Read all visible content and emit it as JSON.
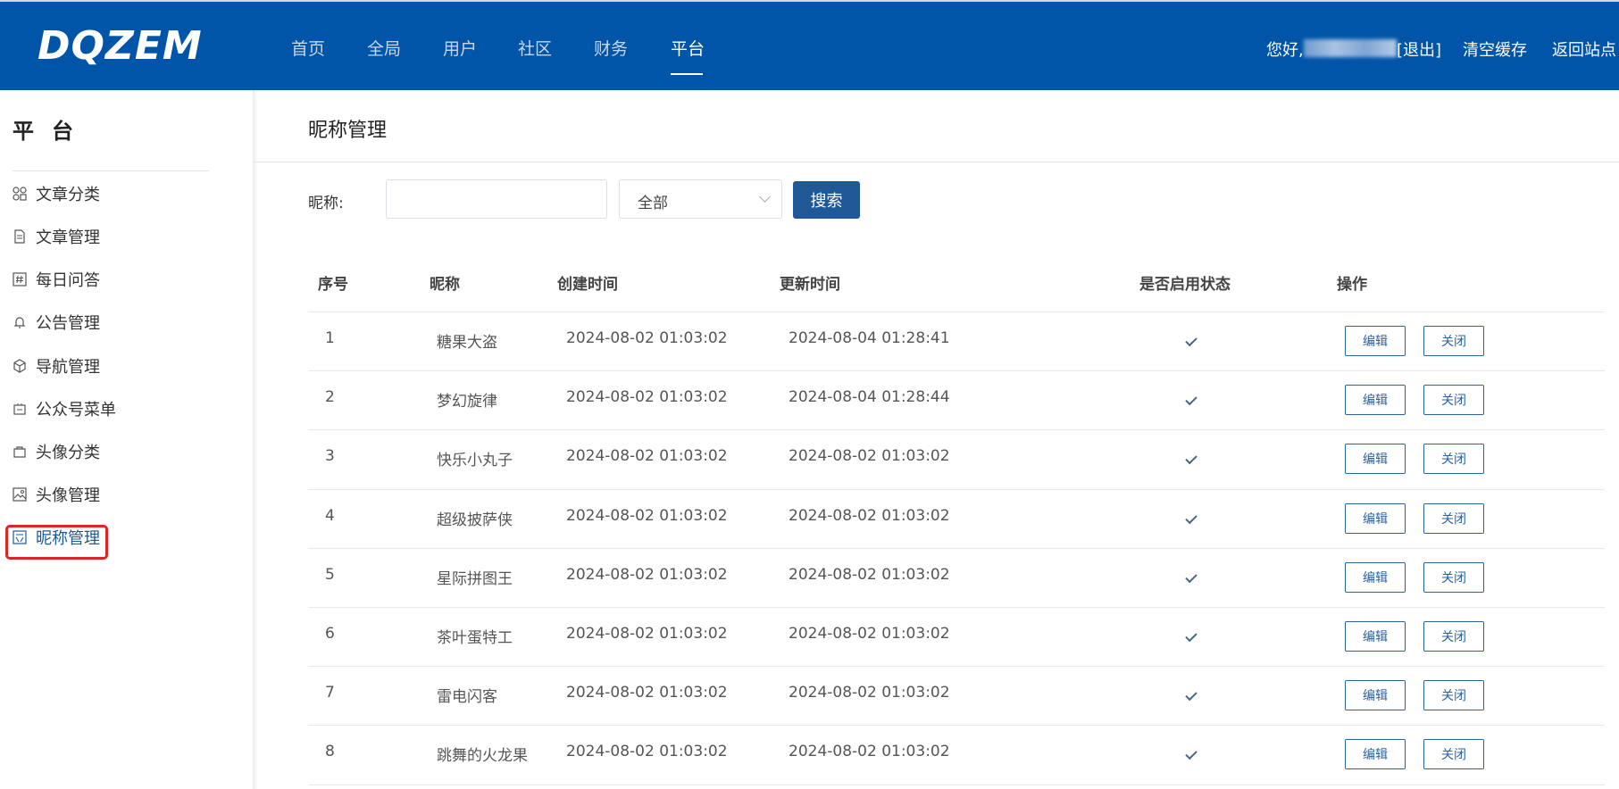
{
  "header": {
    "logo": "DQZEM",
    "nav": [
      "首页",
      "全局",
      "用户",
      "社区",
      "财务",
      "平台"
    ],
    "active_nav": "平台",
    "greeting": "您好,",
    "logout": "[退出]",
    "clear_cache": "清空缓存",
    "back_to_site": "返回站点"
  },
  "sidebar": {
    "title": "平台",
    "items": [
      {
        "label": "文章分类",
        "icon": "category-icon"
      },
      {
        "label": "文章管理",
        "icon": "document-icon"
      },
      {
        "label": "每日问答",
        "icon": "hash-icon"
      },
      {
        "label": "公告管理",
        "icon": "bell-icon"
      },
      {
        "label": "导航管理",
        "icon": "cube-icon"
      },
      {
        "label": "公众号菜单",
        "icon": "menu-icon"
      },
      {
        "label": "头像分类",
        "icon": "bag-icon"
      },
      {
        "label": "头像管理",
        "icon": "image-icon"
      },
      {
        "label": "昵称管理",
        "icon": "nickname-icon"
      }
    ],
    "active_item": "昵称管理"
  },
  "main": {
    "title": "昵称管理",
    "filter": {
      "label": "昵称:",
      "input_value": "",
      "input_placeholder": "",
      "select_value": "全部",
      "search_label": "搜索"
    },
    "table": {
      "headers": [
        "序号",
        "昵称",
        "创建时间",
        "更新时间",
        "是否启用状态",
        "操作"
      ],
      "rows": [
        {
          "id": "1",
          "nickname": "糖果大盗",
          "created": "2024-08-02 01:03:02",
          "updated": "2024-08-04 01:28:41",
          "enabled": true
        },
        {
          "id": "2",
          "nickname": "梦幻旋律",
          "created": "2024-08-02 01:03:02",
          "updated": "2024-08-04 01:28:44",
          "enabled": true
        },
        {
          "id": "3",
          "nickname": "快乐小丸子",
          "created": "2024-08-02 01:03:02",
          "updated": "2024-08-02 01:03:02",
          "enabled": true
        },
        {
          "id": "4",
          "nickname": "超级披萨侠",
          "created": "2024-08-02 01:03:02",
          "updated": "2024-08-02 01:03:02",
          "enabled": true
        },
        {
          "id": "5",
          "nickname": "星际拼图王",
          "created": "2024-08-02 01:03:02",
          "updated": "2024-08-02 01:03:02",
          "enabled": true
        },
        {
          "id": "6",
          "nickname": "茶叶蛋特工",
          "created": "2024-08-02 01:03:02",
          "updated": "2024-08-02 01:03:02",
          "enabled": true
        },
        {
          "id": "7",
          "nickname": "雷电闪客",
          "created": "2024-08-02 01:03:02",
          "updated": "2024-08-02 01:03:02",
          "enabled": true
        },
        {
          "id": "8",
          "nickname": "跳舞的火龙果",
          "created": "2024-08-02 01:03:02",
          "updated": "2024-08-02 01:03:02",
          "enabled": true
        }
      ],
      "edit_label": "编辑",
      "close_label": "关闭"
    }
  },
  "colors": {
    "header_bg": "#0055a8",
    "primary_button": "#1f5797",
    "active_highlight": "#e02424"
  }
}
